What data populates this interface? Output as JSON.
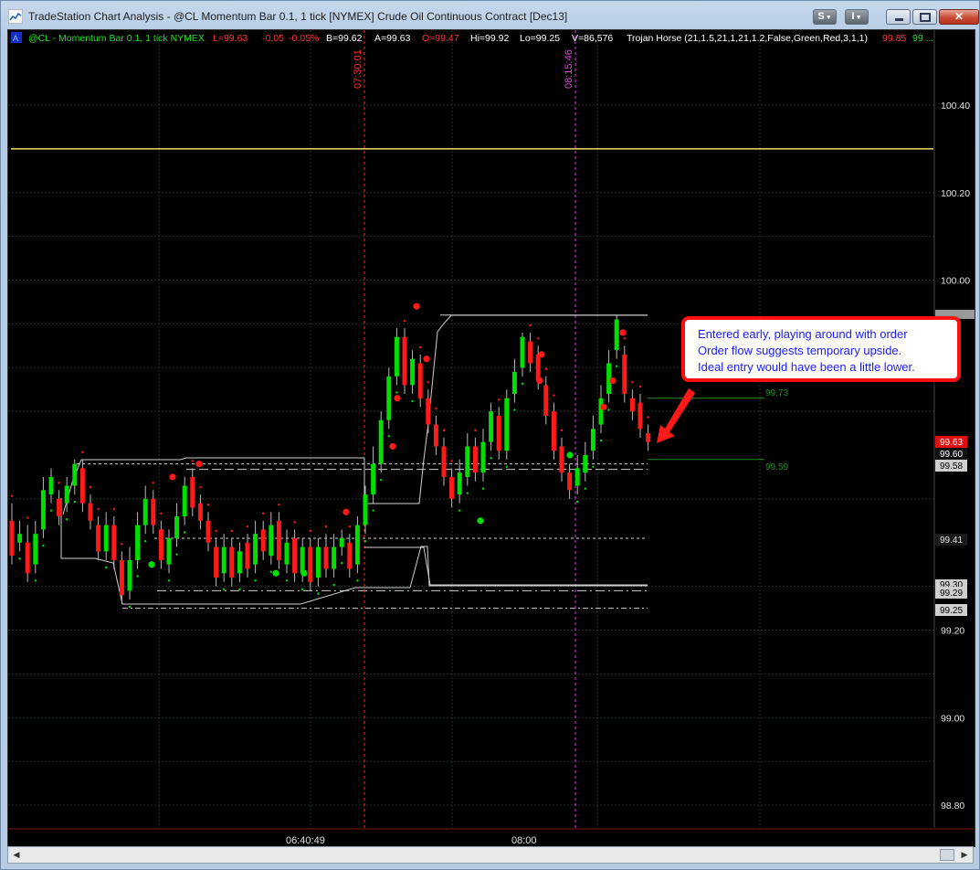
{
  "window": {
    "title": "TradeStation Chart Analysis - @CL Momentum Bar 0.1, 1 tick [NYMEX] Crude Oil Continuous Contract [Dec13]",
    "btn_s": "S",
    "btn_i": "I",
    "close_glyph": "✕"
  },
  "status_bar": {
    "a_box": "A",
    "symbol": "@CL - Momentum Bar 0.1, 1 tick  NYMEX",
    "last": "L=99.63",
    "change": "-0.05",
    "change_pct": "-0.05%",
    "bid": "B=99.62",
    "ask": "A=99.63",
    "open": "O=99.47",
    "high": "Hi=99.92",
    "low": "Lo=99.25",
    "volume": "V=86,576",
    "indicator": "Trojan Horse (21,1.5,21,1,21,1.2,False,Green,Red,3,1,1)",
    "ind_red": "99.85",
    "ind_green": "99 ..."
  },
  "price_axis": {
    "ticks": [
      "100.40",
      "100.20",
      "100.00",
      "99.20",
      "99.00",
      "98.80"
    ],
    "markers": {
      "last": "99.63",
      "p9960": "99.60",
      "p9958": "99.58",
      "p9941": "99.41",
      "p9930": "99.30",
      "p9929": "99.29",
      "p9925": "99.25"
    }
  },
  "time_axis": {
    "ticks": [
      "06:40:49",
      "08:00"
    ]
  },
  "vertical_markers": [
    {
      "label": "07:30:01",
      "color": "#ff2b2b"
    },
    {
      "label": "08:15:46",
      "color": "#e040e0"
    }
  ],
  "level_labels": {
    "upper": "99.73",
    "lower": "99.59"
  },
  "callout": {
    "lines": [
      "Entered early, playing around with order",
      "Order flow suggests temporary upside.",
      "Ideal entry would have been a little lower."
    ]
  },
  "colors": {
    "up_bar": "#00e000",
    "down_bar": "#ff1a1a",
    "yellow_line": "#f0e060",
    "chart_bg": "#000000",
    "callout_border": "#ff1010",
    "callout_text": "#1a1aff"
  },
  "chart_data": {
    "type": "candlestick",
    "instrument": "@CL Momentum Bar 0.1, 1 tick",
    "ylim": [
      98.74,
      100.53
    ],
    "yticks": [
      100.4,
      100.2,
      100.0,
      99.2,
      99.0,
      98.8
    ],
    "horizontal_line": 100.3,
    "levels": {
      "resistance_box_top": 99.92,
      "upper_green_level": 99.73,
      "lower_green_level": 99.59,
      "dashed_top": 99.58,
      "dashed_mid": 99.41,
      "dashed_bottom": 99.29,
      "dashdot_bottom": 99.25
    },
    "bars": [
      {
        "o": 99.45,
        "c": 99.37,
        "h": 99.49,
        "l": 99.35
      },
      {
        "o": 99.4,
        "c": 99.42,
        "h": 99.45,
        "l": 99.38
      },
      {
        "o": 99.4,
        "c": 99.33,
        "h": 99.44,
        "l": 99.31
      },
      {
        "o": 99.35,
        "c": 99.42,
        "h": 99.45,
        "l": 99.33
      },
      {
        "o": 99.43,
        "c": 99.52,
        "h": 99.55,
        "l": 99.41
      },
      {
        "o": 99.51,
        "c": 99.55,
        "h": 99.57,
        "l": 99.49
      },
      {
        "o": 99.5,
        "c": 99.46,
        "h": 99.52,
        "l": 99.44
      },
      {
        "o": 99.49,
        "c": 99.53,
        "h": 99.55,
        "l": 99.47
      },
      {
        "o": 99.53,
        "c": 99.58,
        "h": 99.59,
        "l": 99.51
      },
      {
        "o": 99.57,
        "c": 99.49,
        "h": 99.59,
        "l": 99.47
      },
      {
        "o": 99.49,
        "c": 99.45,
        "h": 99.51,
        "l": 99.43
      },
      {
        "o": 99.44,
        "c": 99.38,
        "h": 99.46,
        "l": 99.36
      },
      {
        "o": 99.38,
        "c": 99.44,
        "h": 99.47,
        "l": 99.36
      },
      {
        "o": 99.44,
        "c": 99.36,
        "h": 99.46,
        "l": 99.34
      },
      {
        "o": 99.36,
        "c": 99.28,
        "h": 99.38,
        "l": 99.26
      },
      {
        "o": 99.29,
        "c": 99.36,
        "h": 99.39,
        "l": 99.27
      },
      {
        "o": 99.36,
        "c": 99.44,
        "h": 99.47,
        "l": 99.34
      },
      {
        "o": 99.44,
        "c": 99.5,
        "h": 99.53,
        "l": 99.42
      },
      {
        "o": 99.5,
        "c": 99.44,
        "h": 99.52,
        "l": 99.42
      },
      {
        "o": 99.43,
        "c": 99.36,
        "h": 99.45,
        "l": 99.34
      },
      {
        "o": 99.35,
        "c": 99.41,
        "h": 99.43,
        "l": 99.33
      },
      {
        "o": 99.41,
        "c": 99.46,
        "h": 99.49,
        "l": 99.39
      },
      {
        "o": 99.46,
        "c": 99.53,
        "h": 99.55,
        "l": 99.44
      },
      {
        "o": 99.55,
        "c": 99.48,
        "h": 99.57,
        "l": 99.46
      },
      {
        "o": 99.49,
        "c": 99.45,
        "h": 99.51,
        "l": 99.43
      },
      {
        "o": 99.45,
        "c": 99.4,
        "h": 99.47,
        "l": 99.38
      },
      {
        "o": 99.39,
        "c": 99.32,
        "h": 99.41,
        "l": 99.3
      },
      {
        "o": 99.33,
        "c": 99.39,
        "h": 99.42,
        "l": 99.31
      },
      {
        "o": 99.39,
        "c": 99.32,
        "h": 99.41,
        "l": 99.3
      },
      {
        "o": 99.33,
        "c": 99.38,
        "h": 99.4,
        "l": 99.31
      },
      {
        "o": 99.4,
        "c": 99.34,
        "h": 99.42,
        "l": 99.32
      },
      {
        "o": 99.35,
        "c": 99.42,
        "h": 99.45,
        "l": 99.33
      },
      {
        "o": 99.43,
        "c": 99.38,
        "h": 99.45,
        "l": 99.36
      },
      {
        "o": 99.37,
        "c": 99.44,
        "h": 99.47,
        "l": 99.35
      },
      {
        "o": 99.45,
        "c": 99.36,
        "h": 99.47,
        "l": 99.34
      },
      {
        "o": 99.35,
        "c": 99.4,
        "h": 99.43,
        "l": 99.33
      },
      {
        "o": 99.41,
        "c": 99.33,
        "h": 99.43,
        "l": 99.31
      },
      {
        "o": 99.33,
        "c": 99.39,
        "h": 99.41,
        "l": 99.31
      },
      {
        "o": 99.39,
        "c": 99.31,
        "h": 99.41,
        "l": 99.29
      },
      {
        "o": 99.32,
        "c": 99.39,
        "h": 99.41,
        "l": 99.3
      },
      {
        "o": 99.39,
        "c": 99.34,
        "h": 99.42,
        "l": 99.32
      },
      {
        "o": 99.34,
        "c": 99.39,
        "h": 99.42,
        "l": 99.32
      },
      {
        "o": 99.39,
        "c": 99.41,
        "h": 99.43,
        "l": 99.37
      },
      {
        "o": 99.4,
        "c": 99.34,
        "h": 99.42,
        "l": 99.32
      },
      {
        "o": 99.35,
        "c": 99.44,
        "h": 99.46,
        "l": 99.33
      },
      {
        "o": 99.44,
        "c": 99.51,
        "h": 99.53,
        "l": 99.42
      },
      {
        "o": 99.51,
        "c": 99.58,
        "h": 99.62,
        "l": 99.49
      },
      {
        "o": 99.58,
        "c": 99.68,
        "h": 99.7,
        "l": 99.56
      },
      {
        "o": 99.68,
        "c": 99.78,
        "h": 99.8,
        "l": 99.66
      },
      {
        "o": 99.78,
        "c": 99.87,
        "h": 99.89,
        "l": 99.76
      },
      {
        "o": 99.87,
        "c": 99.76,
        "h": 99.89,
        "l": 99.74
      },
      {
        "o": 99.76,
        "c": 99.82,
        "h": 99.84,
        "l": 99.74
      },
      {
        "o": 99.81,
        "c": 99.73,
        "h": 99.83,
        "l": 99.71
      },
      {
        "o": 99.73,
        "c": 99.67,
        "h": 99.75,
        "l": 99.65
      },
      {
        "o": 99.67,
        "c": 99.62,
        "h": 99.69,
        "l": 99.6
      },
      {
        "o": 99.62,
        "c": 99.55,
        "h": 99.64,
        "l": 99.53
      },
      {
        "o": 99.55,
        "c": 99.5,
        "h": 99.57,
        "l": 99.48
      },
      {
        "o": 99.51,
        "c": 99.56,
        "h": 99.59,
        "l": 99.49
      },
      {
        "o": 99.55,
        "c": 99.62,
        "h": 99.65,
        "l": 99.53
      },
      {
        "o": 99.62,
        "c": 99.56,
        "h": 99.64,
        "l": 99.54
      },
      {
        "o": 99.56,
        "c": 99.63,
        "h": 99.66,
        "l": 99.54
      },
      {
        "o": 99.63,
        "c": 99.7,
        "h": 99.72,
        "l": 99.61
      },
      {
        "o": 99.69,
        "c": 99.61,
        "h": 99.71,
        "l": 99.59
      },
      {
        "o": 99.61,
        "c": 99.73,
        "h": 99.75,
        "l": 99.59
      },
      {
        "o": 99.74,
        "c": 99.79,
        "h": 99.82,
        "l": 99.72
      },
      {
        "o": 99.8,
        "c": 99.87,
        "h": 99.88,
        "l": 99.78
      },
      {
        "o": 99.86,
        "c": 99.81,
        "h": 99.88,
        "l": 99.79
      },
      {
        "o": 99.83,
        "c": 99.77,
        "h": 99.85,
        "l": 99.75
      },
      {
        "o": 99.76,
        "c": 99.69,
        "h": 99.78,
        "l": 99.67
      },
      {
        "o": 99.7,
        "c": 99.61,
        "h": 99.72,
        "l": 99.59
      },
      {
        "o": 99.62,
        "c": 99.56,
        "h": 99.64,
        "l": 99.54
      },
      {
        "o": 99.56,
        "c": 99.52,
        "h": 99.58,
        "l": 99.5
      },
      {
        "o": 99.53,
        "c": 99.57,
        "h": 99.6,
        "l": 99.51
      },
      {
        "o": 99.56,
        "c": 99.6,
        "h": 99.63,
        "l": 99.54
      },
      {
        "o": 99.61,
        "c": 99.66,
        "h": 99.69,
        "l": 99.59
      },
      {
        "o": 99.67,
        "c": 99.73,
        "h": 99.76,
        "l": 99.65
      },
      {
        "o": 99.74,
        "c": 99.81,
        "h": 99.84,
        "l": 99.72
      },
      {
        "o": 99.84,
        "c": 99.91,
        "h": 99.92,
        "l": 99.82
      },
      {
        "o": 99.83,
        "c": 99.74,
        "h": 99.85,
        "l": 99.72
      },
      {
        "o": 99.73,
        "c": 99.7,
        "h": 99.75,
        "l": 99.68
      },
      {
        "o": 99.72,
        "c": 99.66,
        "h": 99.74,
        "l": 99.64
      },
      {
        "o": 99.65,
        "c": 99.63,
        "h": 99.67,
        "l": 99.61
      }
    ]
  }
}
